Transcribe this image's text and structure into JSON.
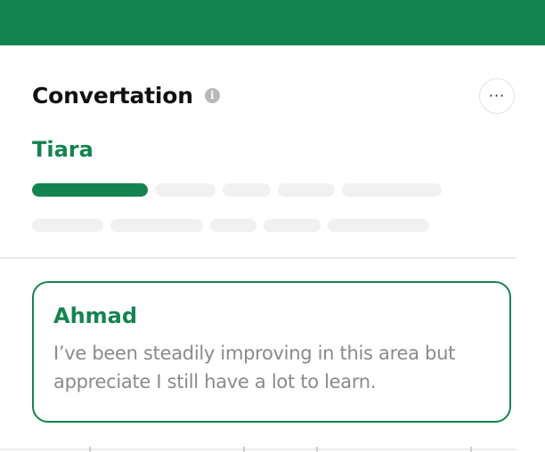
{
  "header": {
    "title": "Convertation",
    "info_icon": "info-icon",
    "more_icon": "more-horizontal-icon",
    "more_label": "···"
  },
  "transcript": {
    "speaker": "Tiara",
    "progress_segments_filled": 1
  },
  "card": {
    "speaker": "Ahmad",
    "text": "I’ve been steadily improving in this area but appreciate I still have a lot to learn."
  },
  "colors": {
    "accent": "#13844f",
    "placeholder": "#f1f1f1",
    "muted_text": "#8a8a8a"
  }
}
